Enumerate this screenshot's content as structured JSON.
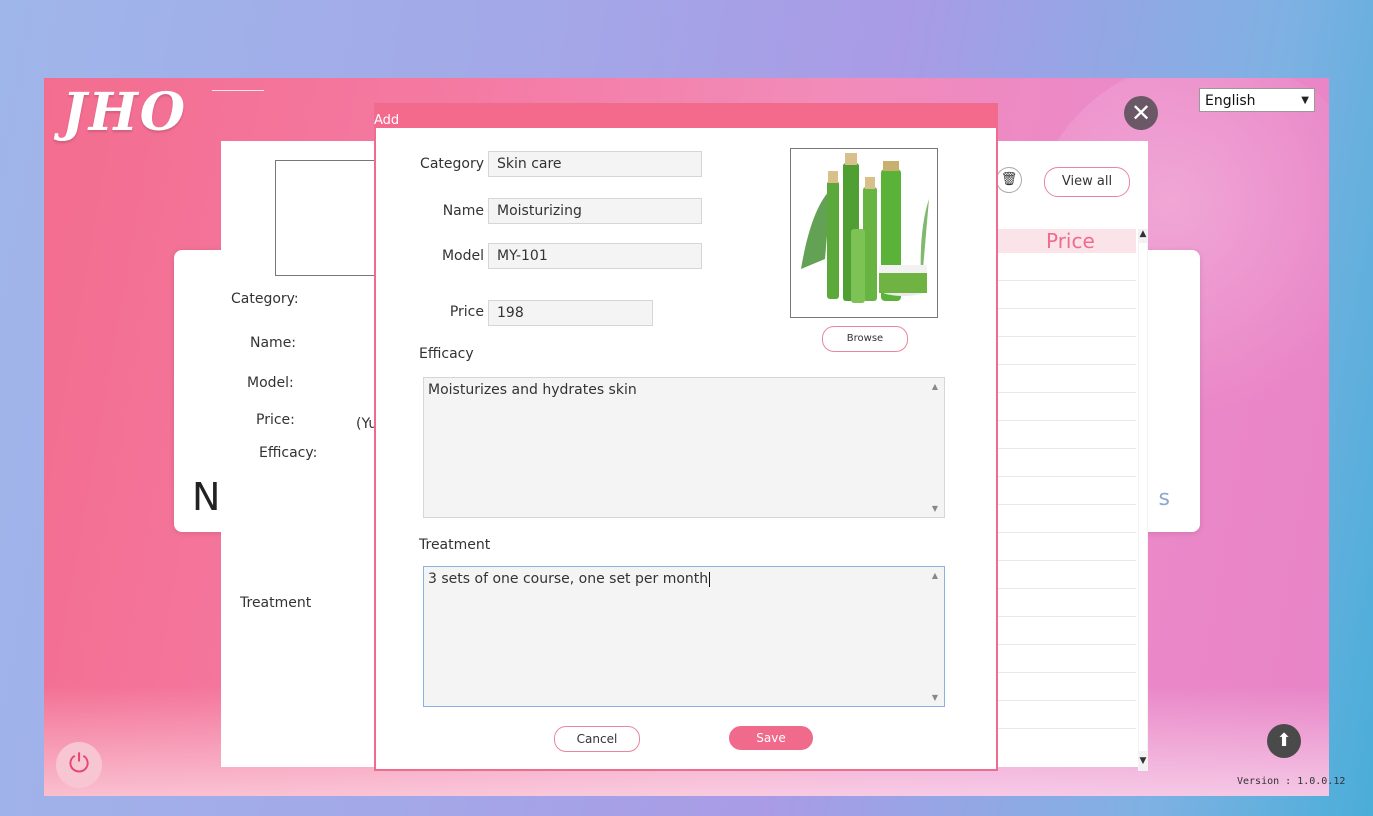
{
  "app": {
    "logo": "JHO",
    "language": "English",
    "version": "Version : 1.0.0.12"
  },
  "background_form": {
    "labels": {
      "category": "Category:",
      "name": "Name:",
      "model": "Model:",
      "price": "Price:",
      "price_unit_partial": "(Yu",
      "efficacy": "Efficacy:",
      "treatment": "Treatment"
    },
    "view_all": "View all",
    "price_header": "Price",
    "partial_letter": "N",
    "partial_right": "s"
  },
  "dialog": {
    "title": "Add",
    "fields": {
      "category": {
        "label": "Category",
        "value": "Skin care"
      },
      "name": {
        "label": "Name",
        "value": "Moisturizing"
      },
      "model": {
        "label": "Model",
        "value": "MY-101"
      },
      "price": {
        "label": "Price",
        "value": "198"
      }
    },
    "browse_label": "Browse",
    "efficacy": {
      "label": "Efficacy",
      "value": "Moisturizes and hydrates skin"
    },
    "treatment": {
      "label": "Treatment",
      "value": "3 sets of one course, one set per month"
    },
    "cancel_label": "Cancel",
    "save_label": "Save"
  },
  "icons": {
    "close": "close-icon",
    "power": "power-icon",
    "up": "arrow-up-icon",
    "trash": "trash-icon"
  },
  "colors": {
    "accent": "#f06a8c",
    "header_bg": "#fbe3ea"
  }
}
